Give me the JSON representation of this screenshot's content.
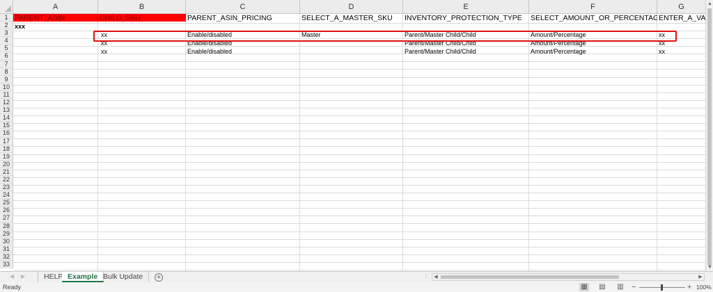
{
  "columns": [
    "A",
    "B",
    "C",
    "D",
    "E",
    "F",
    "G"
  ],
  "rows": [
    "1",
    "2",
    "3",
    "4",
    "5",
    "6",
    "7",
    "8",
    "9",
    "10",
    "11",
    "12",
    "13",
    "14",
    "15",
    "16",
    "17",
    "18",
    "19",
    "20",
    "21",
    "22",
    "23",
    "24",
    "25",
    "26",
    "27",
    "28",
    "29",
    "30",
    "31",
    "32",
    "33"
  ],
  "header_row": [
    "PARENT_ASIN",
    "CHILD_SKU",
    "PARENT_ASIN_PRICING",
    "SELECT_A_MASTER_SKU",
    "INVENTORY_PROTECTION_TYPE",
    "SELECT_AMOUNT_OR_PERCENTAGE",
    "ENTER_A_VALU"
  ],
  "row2": {
    "a": "xxx"
  },
  "data_rows": [
    {
      "b": "xx",
      "c": "Enable/disabled",
      "d": "Master",
      "e": "Parent/Master Child/Child",
      "f": "Amount/Percentage",
      "g": "xx"
    },
    {
      "b": "xx",
      "c": "Enable/disabled",
      "d": "",
      "e": "Parent/Master Child/Child",
      "f": "Amount/Percentage",
      "g": "xx"
    },
    {
      "b": "xx",
      "c": "Enable/disabled",
      "d": "",
      "e": "Parent/Master Child/Child",
      "f": "Amount/Percentage",
      "g": "xx"
    }
  ],
  "colors": {
    "header_fill": "#ff0000",
    "highlight_border": "#e01010",
    "active_tab": "#217346"
  },
  "sheet_tabs": [
    "HELP",
    "Example",
    "Bulk Update"
  ],
  "active_tab": "Example",
  "add_sheet_label": "+",
  "status": {
    "text": "Ready",
    "zoom": "100%",
    "minus": "−",
    "plus": "+"
  },
  "icons": {
    "view_normal": "grid-icon",
    "view_layout": "page-layout-icon",
    "view_break": "page-break-icon"
  }
}
